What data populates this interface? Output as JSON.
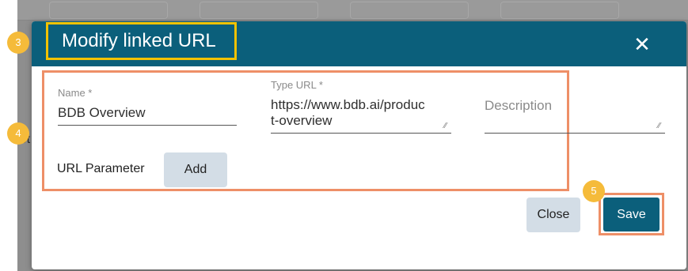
{
  "modal": {
    "title": "Modify linked URL",
    "close_icon": "close-icon"
  },
  "form": {
    "name": {
      "label": "Name *",
      "value": "BDB Overview"
    },
    "type_url": {
      "label": "Type URL *",
      "value_line1": "https://www.bdb.ai/produc",
      "value_line2": "t-overview"
    },
    "description": {
      "placeholder": "Description"
    },
    "url_parameter_label": "URL Parameter",
    "add_label": "Add"
  },
  "footer": {
    "close_label": "Close",
    "save_label": "Save"
  },
  "annotations": {
    "step_3": "3",
    "step_4": "4",
    "step_5": "5"
  },
  "background": {
    "partial_text": "St"
  },
  "colors": {
    "header": "#0b5f7b",
    "highlight_yellow": "#f2c200",
    "highlight_orange": "#ee8f67",
    "badge": "#f5bb3a",
    "secondary_button": "#d3dde6"
  }
}
